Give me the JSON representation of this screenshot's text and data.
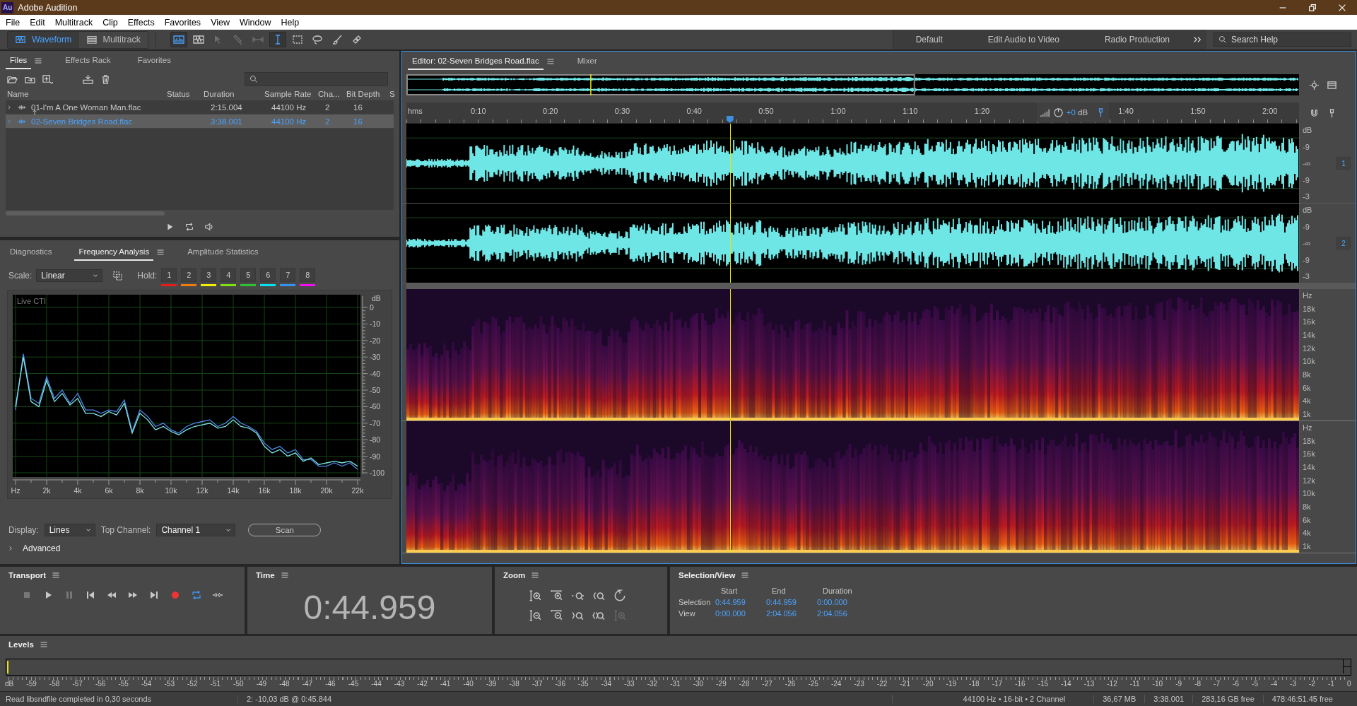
{
  "window": {
    "badge": "Au",
    "title": "Adobe Audition"
  },
  "menu": [
    "File",
    "Edit",
    "Multitrack",
    "Clip",
    "Effects",
    "Favorites",
    "View",
    "Window",
    "Help"
  ],
  "toolbar": {
    "modes": [
      {
        "label": "Waveform",
        "kind": "waveform",
        "selected": true
      },
      {
        "label": "Multitrack",
        "kind": "multitrack",
        "selected": false
      }
    ],
    "tools": [
      {
        "kind": "spectral",
        "selected": true,
        "disabled": false
      },
      {
        "kind": "waveform",
        "selected": false,
        "disabled": false
      },
      {
        "kind": "move",
        "selected": false,
        "disabled": true
      },
      {
        "kind": "razor",
        "selected": false,
        "disabled": true
      },
      {
        "kind": "slip",
        "selected": false,
        "disabled": true
      },
      {
        "kind": "time-selection",
        "selected": true,
        "disabled": false
      },
      {
        "kind": "marquee",
        "selected": false,
        "disabled": false
      },
      {
        "kind": "lasso",
        "selected": false,
        "disabled": false
      },
      {
        "kind": "brush",
        "selected": false,
        "disabled": false
      },
      {
        "kind": "spot-heal",
        "selected": false,
        "disabled": false
      }
    ],
    "workspaces": [
      "Default",
      "Edit Audio to Video",
      "Radio Production"
    ],
    "search": {
      "placeholder": "Search Help"
    }
  },
  "files_panel": {
    "tabs": [
      {
        "label": "Files",
        "selected": true
      },
      {
        "label": "Effects Rack",
        "selected": false
      },
      {
        "label": "Favorites",
        "selected": false
      }
    ],
    "columns": [
      "Name",
      "Status",
      "Duration",
      "Sample Rate",
      "Cha...",
      "Bit Depth",
      "S"
    ],
    "rows": [
      {
        "name": "01-I'm A One Woman Man.flac",
        "duration": "2:15.004",
        "sample_rate": "44100 Hz",
        "channels": "2",
        "bit_depth": "16",
        "selected": false
      },
      {
        "name": "02-Seven Bridges Road.flac",
        "duration": "3:38.001",
        "sample_rate": "44100 Hz",
        "channels": "2",
        "bit_depth": "16",
        "selected": true
      }
    ]
  },
  "analysis_panel": {
    "tabs": [
      {
        "label": "Diagnostics",
        "selected": false
      },
      {
        "label": "Frequency Analysis",
        "selected": true
      },
      {
        "label": "Amplitude Statistics",
        "selected": false
      }
    ],
    "scale": {
      "label": "Scale:",
      "value": "Linear"
    },
    "hold": {
      "label": "Hold:",
      "buttons": [
        {
          "label": "1",
          "color": "#e81c1c"
        },
        {
          "label": "2",
          "color": "#f07c10"
        },
        {
          "label": "3",
          "color": "#f0f000"
        },
        {
          "label": "4",
          "color": "#80e010"
        },
        {
          "label": "5",
          "color": "#30c030"
        },
        {
          "label": "6",
          "color": "#00e4f0"
        },
        {
          "label": "7",
          "color": "#3094f0"
        },
        {
          "label": "8",
          "color": "#f010f0"
        }
      ]
    },
    "chart_label": "Live CTI",
    "chart_data": {
      "type": "line",
      "ylabel": "dB",
      "grid": true,
      "x": [
        0,
        500,
        1000,
        1500,
        2000,
        2500,
        3000,
        3500,
        4000,
        4500,
        5000,
        5500,
        6000,
        6500,
        7000,
        7500,
        8000,
        8500,
        9000,
        9500,
        10000,
        10500,
        11000,
        11500,
        12000,
        12500,
        13000,
        13500,
        14000,
        14500,
        15000,
        15500,
        16000,
        16500,
        17000,
        17500,
        18000,
        18500,
        19000,
        19500,
        20000,
        20500,
        21000,
        21500,
        22000
      ],
      "series": [
        {
          "color": "#4f86e8",
          "values": [
            -62,
            -28,
            -55,
            -58,
            -42,
            -55,
            -50,
            -58,
            -52,
            -62,
            -62,
            -64,
            -62,
            -63,
            -56,
            -75,
            -62,
            -66,
            -72,
            -70,
            -74,
            -76,
            -72,
            -70,
            -69,
            -68,
            -72,
            -70,
            -66,
            -70,
            -72,
            -75,
            -82,
            -86,
            -84,
            -88,
            -86,
            -92,
            -92,
            -96,
            -96,
            -94,
            -96,
            -94,
            -98
          ]
        },
        {
          "color": "#7ee6e6",
          "values": [
            -60,
            -30,
            -57,
            -60,
            -44,
            -57,
            -52,
            -59,
            -55,
            -64,
            -64,
            -66,
            -63,
            -65,
            -58,
            -76,
            -64,
            -68,
            -74,
            -72,
            -75,
            -77,
            -74,
            -72,
            -71,
            -70,
            -73,
            -72,
            -68,
            -72,
            -73,
            -76,
            -84,
            -88,
            -86,
            -90,
            -88,
            -93,
            -91,
            -95,
            -94,
            -93,
            -94,
            -93,
            -96
          ]
        }
      ],
      "xlim": [
        0,
        22000
      ],
      "ylim": [
        -100,
        0
      ],
      "xticks": [
        {
          "value": 0,
          "label": "Hz"
        },
        {
          "value": 2000,
          "label": "2k"
        },
        {
          "value": 4000,
          "label": "4k"
        },
        {
          "value": 6000,
          "label": "6k"
        },
        {
          "value": 8000,
          "label": "8k"
        },
        {
          "value": 10000,
          "label": "10k"
        },
        {
          "value": 12000,
          "label": "12k"
        },
        {
          "value": 14000,
          "label": "14k"
        },
        {
          "value": 16000,
          "label": "16k"
        },
        {
          "value": 18000,
          "label": "18k"
        },
        {
          "value": 20000,
          "label": "20k"
        },
        {
          "value": 22000,
          "label": "22k"
        }
      ],
      "yticks": [
        0,
        -10,
        -20,
        -30,
        -40,
        -50,
        -60,
        -70,
        -80,
        -90,
        -100
      ]
    },
    "display": {
      "label": "Display:",
      "value": "Lines"
    },
    "top_channel": {
      "label": "Top Channel:",
      "value": "Channel 1"
    },
    "scan_button": "Scan",
    "advanced": {
      "label": "Advanced",
      "expanded": false
    }
  },
  "editor": {
    "tabs": [
      {
        "label": "Editor: 02-Seven Bridges Road.flac",
        "selected": true
      },
      {
        "label": "Mixer",
        "selected": false
      }
    ],
    "ruler": {
      "unit": "hms",
      "labels": [
        "0:10",
        "0:20",
        "0:30",
        "0:40",
        "0:50",
        "1:00",
        "1:10",
        "1:20",
        "1:40",
        "1:50",
        "2:00"
      ]
    },
    "hud": {
      "gain": "+0",
      "unit": "dB"
    },
    "channels": [
      {
        "badge": "1",
        "scale": [
          "dB",
          "-9",
          "-∞",
          "-9",
          "-3"
        ]
      },
      {
        "badge": "2",
        "scale": [
          "dB",
          "-9",
          "-∞",
          "-9",
          "-3"
        ]
      }
    ],
    "spectral_channels": [
      {
        "scale": [
          "Hz",
          "18k",
          "16k",
          "14k",
          "12k",
          "10k",
          "8k",
          "6k",
          "4k",
          "1k"
        ]
      },
      {
        "scale": [
          "Hz",
          "18k",
          "16k",
          "14k",
          "12k",
          "10k",
          "8k",
          "6k",
          "4k",
          "1k"
        ]
      }
    ]
  },
  "transport": {
    "title": "Transport",
    "buttons": [
      {
        "kind": "stop",
        "disabled": true,
        "selected": false
      },
      {
        "kind": "play",
        "disabled": false,
        "selected": false
      },
      {
        "kind": "pause",
        "disabled": true,
        "selected": false
      },
      {
        "kind": "to-start",
        "disabled": false,
        "selected": false
      },
      {
        "kind": "rewind",
        "disabled": false,
        "selected": false
      },
      {
        "kind": "fast-forward",
        "disabled": false,
        "selected": false
      },
      {
        "kind": "to-end",
        "disabled": false,
        "selected": false
      },
      {
        "kind": "record",
        "disabled": false,
        "selected": false
      },
      {
        "kind": "loop",
        "disabled": false,
        "selected": true
      },
      {
        "kind": "skip",
        "disabled": false,
        "selected": false
      }
    ]
  },
  "time": {
    "title": "Time",
    "value": "0:44.959"
  },
  "zoom": {
    "title": "Zoom",
    "buttons": [
      {
        "kind": "zoom-in-amp",
        "disabled": false
      },
      {
        "kind": "zoom-in-time",
        "disabled": false
      },
      {
        "kind": "zoom-selection",
        "disabled": false
      },
      {
        "kind": "zoom-in-point",
        "disabled": false
      },
      {
        "kind": "zoom-reset",
        "disabled": false
      },
      {
        "kind": "zoom-out-amp",
        "disabled": false
      },
      {
        "kind": "zoom-out-time",
        "disabled": false
      },
      {
        "kind": "zoom-out-point",
        "disabled": false
      },
      {
        "kind": "zoom-full",
        "disabled": false
      },
      {
        "kind": "zoom-in-amp",
        "disabled": true
      }
    ]
  },
  "selection_view": {
    "title": "Selection/View",
    "columns": [
      "Start",
      "End",
      "Duration"
    ],
    "rows": [
      {
        "label": "Selection",
        "values": [
          "0:44.959",
          "0:44.959",
          "0:00.000"
        ]
      },
      {
        "label": "View",
        "values": [
          "0:00.000",
          "2:04.056",
          "2:04.056"
        ]
      }
    ]
  },
  "levels": {
    "title": "Levels",
    "scale": [
      "dB",
      "-59",
      "-58",
      "-57",
      "-56",
      "-55",
      "-54",
      "-53",
      "-52",
      "-51",
      "-50",
      "-49",
      "-48",
      "-47",
      "-46",
      "-45",
      "-44",
      "-43",
      "-42",
      "-41",
      "-40",
      "-39",
      "-38",
      "-37",
      "-36",
      "-35",
      "-34",
      "-33",
      "-32",
      "-31",
      "-30",
      "-29",
      "-28",
      "-27",
      "-26",
      "-25",
      "-24",
      "-23",
      "-22",
      "-21",
      "-20",
      "-19",
      "-18",
      "-17",
      "-16",
      "-15",
      "-14",
      "-13",
      "-12",
      "-11",
      "-10",
      "-9",
      "-8",
      "-7",
      "-6",
      "-5",
      "-4",
      "-3",
      "-2",
      "-1",
      "0"
    ]
  },
  "status_bar": {
    "message": "Read libsndfile completed in 0,30 seconds",
    "cursor": "2: -10,03 dB @ 0:45.844",
    "format": "44100 Hz • 16-bit • 2 Channel",
    "size": "36,67 MB",
    "duration": "3:38.001",
    "disk_free": "283,16 GB free",
    "time_free": "478:46:51.45 free"
  }
}
